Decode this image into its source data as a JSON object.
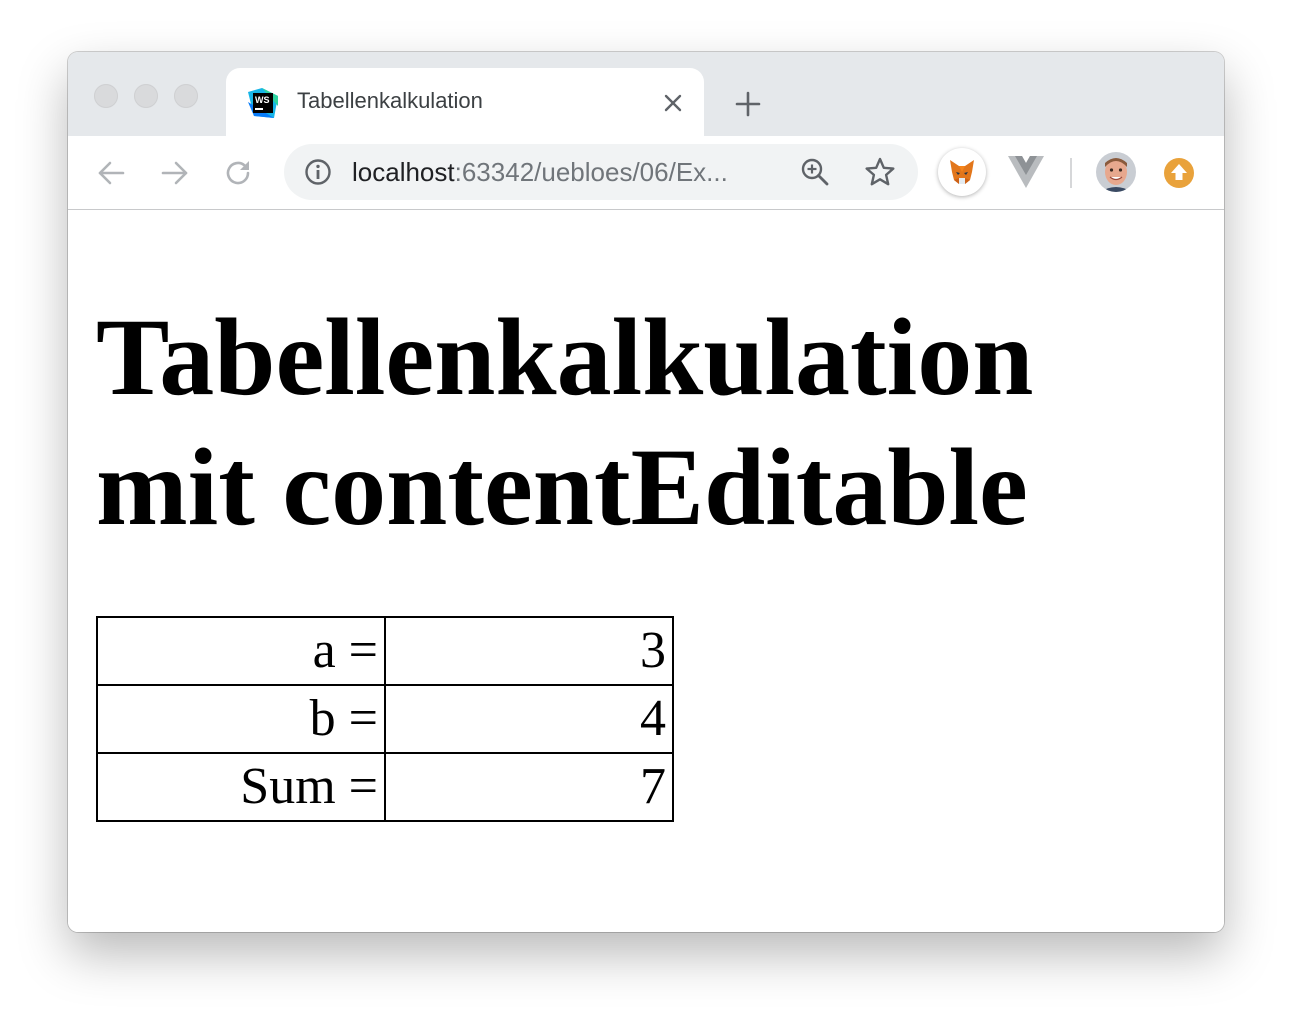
{
  "browser": {
    "tab": {
      "title": "Tabellenkalkulation",
      "favicon": "webstorm-icon"
    },
    "address": {
      "host": "localhost",
      "rest": ":63342/uebloes/06/Ex..."
    },
    "toolbar_icons": [
      "back-icon",
      "forward-icon",
      "reload-icon",
      "info-icon",
      "zoom-icon",
      "star-icon",
      "metamask-extension-icon",
      "vue-devtools-icon",
      "avatar",
      "update-icon"
    ]
  },
  "page": {
    "heading": "Tabellenkalkulation mit contentEditable",
    "table": {
      "rows": [
        {
          "label": "a =",
          "value": "3"
        },
        {
          "label": "b =",
          "value": "4"
        },
        {
          "label": "Sum =",
          "value": "7"
        }
      ]
    }
  },
  "colors": {
    "tabstrip": "#e5e8eb",
    "omnibox": "#f1f3f4",
    "update_badge": "#e9a23b"
  }
}
